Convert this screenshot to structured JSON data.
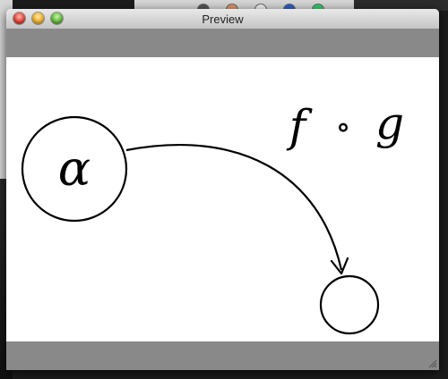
{
  "window": {
    "title": "Preview"
  },
  "diagram": {
    "formula_f": "f",
    "formula_op": "∘",
    "formula_g": "g",
    "node_label": "α"
  },
  "colors": {
    "band": "#898989",
    "canvas": "#ffffff",
    "stroke": "#000000"
  },
  "icons": {
    "close": "close-icon",
    "minimize": "minimize-icon",
    "zoom": "zoom-icon",
    "resize": "resize-grip-icon"
  }
}
